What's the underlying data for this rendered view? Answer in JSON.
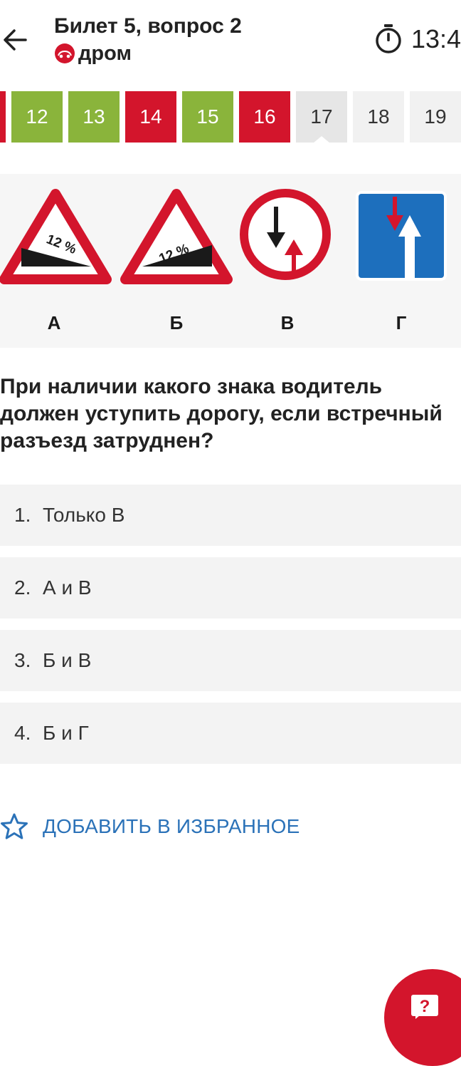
{
  "header": {
    "title": "Билет 5, вопрос 2",
    "brand": "дром",
    "timer": "13:4"
  },
  "question_numbers": [
    {
      "label": "",
      "status": "red"
    },
    {
      "label": "12",
      "status": "green"
    },
    {
      "label": "13",
      "status": "green"
    },
    {
      "label": "14",
      "status": "red"
    },
    {
      "label": "15",
      "status": "green"
    },
    {
      "label": "16",
      "status": "red"
    },
    {
      "label": "17",
      "status": "current"
    },
    {
      "label": "18",
      "status": "unanswered"
    },
    {
      "label": "19",
      "status": "unanswered"
    }
  ],
  "signs": {
    "labels": [
      "А",
      "Б",
      "В",
      "Г"
    ],
    "slope_text": "12 %"
  },
  "question": {
    "text": "При наличии какого знака водитель должен уступить дорогу, если встречный разъезд затруднен?"
  },
  "answers": [
    {
      "num": "1.",
      "text": "Только В"
    },
    {
      "num": "2.",
      "text": "А и В"
    },
    {
      "num": "3.",
      "text": "Б и В"
    },
    {
      "num": "4.",
      "text": "Б и Г"
    }
  ],
  "favorite": {
    "label": "ДОБАВИТЬ В ИЗБРАННОЕ"
  },
  "colors": {
    "green": "#8ab43b",
    "red": "#d3152c",
    "link_blue": "#2b72b8",
    "answer_bg": "#f3f3f3"
  }
}
